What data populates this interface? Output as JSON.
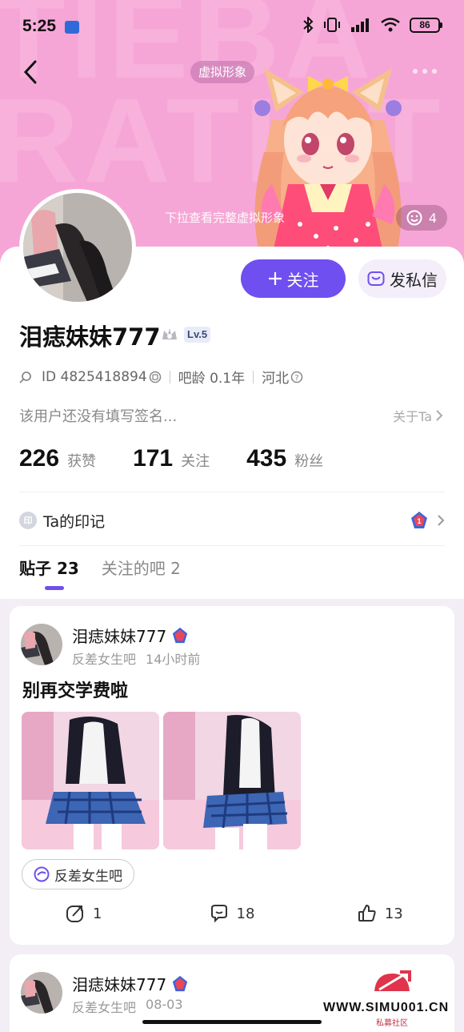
{
  "status_bar": {
    "time": "5:25",
    "battery": "86"
  },
  "header": {
    "banner_letters": "TIEBA\nRATIST",
    "avatar_tag": "虚拟形象",
    "pull_hint": "下拉查看完整虚拟形象",
    "likes": "4"
  },
  "profile": {
    "username": "泪痣妹妹777",
    "level": "Lv.5",
    "follow_label": "关注",
    "message_label": "发私信",
    "id_text": "ID 4825418894",
    "bar_age": "吧龄 0.1年",
    "location": "河北",
    "signature": "该用户还没有填写签名...",
    "about_link": "关于Ta",
    "stats": [
      {
        "value": "226",
        "label": "获赞"
      },
      {
        "value": "171",
        "label": "关注"
      },
      {
        "value": "435",
        "label": "粉丝"
      }
    ],
    "marks_icon_text": "印",
    "marks_title": "Ta的印记",
    "badge_number": "1"
  },
  "tabs": [
    {
      "label": "贴子 23",
      "active": true
    },
    {
      "label": "关注的吧 2",
      "active": false
    }
  ],
  "posts": [
    {
      "author": "泪痣妹妹777",
      "bar": "反差女生吧",
      "time": "14小时前",
      "title": "别再交学费啦",
      "bar_tag": "反差女生吧",
      "shares": "1",
      "comments": "18",
      "likes": "13"
    },
    {
      "author": "泪痣妹妹777",
      "bar": "反差女生吧",
      "time": "08-03"
    }
  ],
  "watermark": {
    "text": "WWW.SIMU001.CN",
    "sub": "私募社区"
  },
  "colors": {
    "accent": "#6f4ff0",
    "banner": "#f6a6d6"
  }
}
